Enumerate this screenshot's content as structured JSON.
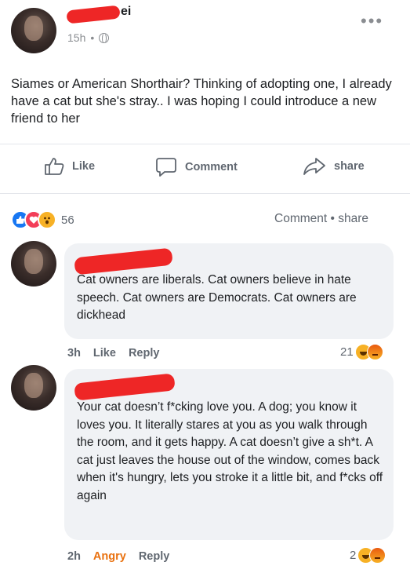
{
  "post": {
    "author_visible": "ei",
    "time": "15h",
    "privacy_icon": "globe-icon",
    "more_icon": "•••",
    "text": "Siames or American Shorthair? Thinking of adopting one, I already have a cat but she's stray.. I was hoping I could introduce a new friend to her"
  },
  "actions": {
    "like": "Like",
    "comment": "Comment",
    "share": "share"
  },
  "reactions": {
    "icons": [
      "like-icon",
      "love-icon",
      "wow-icon"
    ],
    "count": "56",
    "comment_label": "Comment",
    "separator": "•",
    "share_label": "share"
  },
  "comments": [
    {
      "text": "Cat owners are liberals. Cat owners believe in hate speech. Cat owners are Democrats. Cat owners are dickhead",
      "time": "3h",
      "reaction_label": "Like",
      "reply": "Reply",
      "reaction_count": "21",
      "reaction_icons": [
        "haha-icon",
        "angry-icon"
      ]
    },
    {
      "text": "Your cat doesn’t f*cking love you. A dog; you know it loves you. It literally stares at you as you walk through the room, and it gets happy. A cat doesn’t give a sh*t. A cat just leaves the house out of the window, comes back when it's hungry, lets you stroke it a little bit, and f*cks off again",
      "time": "2h",
      "reaction_label": "Angry",
      "reply": "Reply",
      "reaction_count": "2",
      "reaction_icons": [
        "haha-icon",
        "angry-icon"
      ]
    }
  ],
  "colors": {
    "accent": "#1877f2",
    "redaction": "#ee2626",
    "angry": "#e9710f",
    "bubble": "#f0f2f5"
  }
}
